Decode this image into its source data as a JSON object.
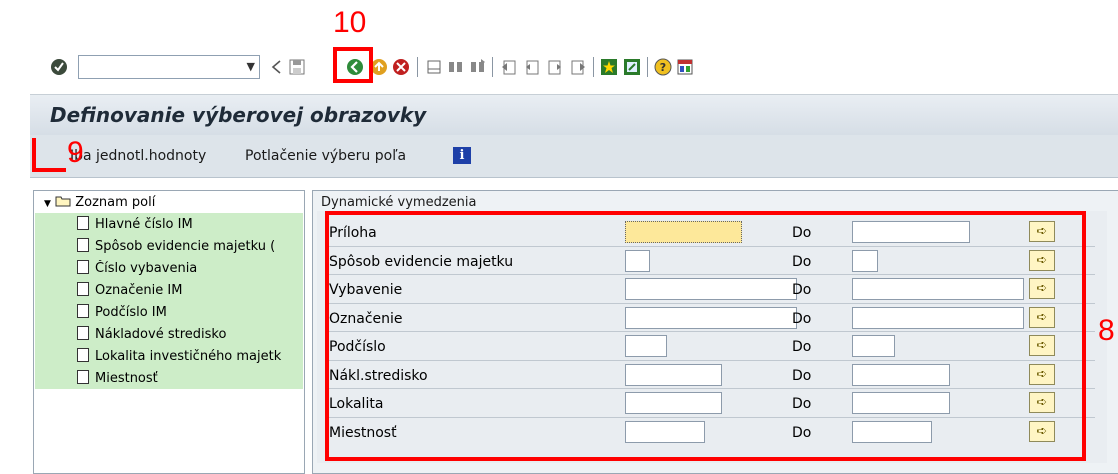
{
  "toolbar": {
    "command_field_value": "",
    "icons": [
      "enter-icon",
      "command-dropdown-icon",
      "back-arrow-icon",
      "save-icon",
      "back-icon",
      "exit-icon",
      "cancel-icon",
      "print-icon",
      "find-icon",
      "find-next-icon",
      "first-page-icon",
      "prev-page-icon",
      "next-page-icon",
      "last-page-icon",
      "new-session-icon",
      "shortcut-icon",
      "help-icon",
      "layout-icon"
    ]
  },
  "title": "Definovanie výberovej obrazovky",
  "app_toolbar": {
    "single_values": "Iba jednotl.hodnoty",
    "suppress_selection": "Potlačenie výberu poľa"
  },
  "tree": {
    "root": "Zoznam polí",
    "items": [
      "Hlavné číslo IM",
      "Spôsob evidencie majetku (",
      "Číslo vybavenia",
      "Označenie IM",
      "Podčíslo IM",
      "Nákladové stredisko",
      "Lokalita investičného majetk",
      "Miestnosť"
    ]
  },
  "group": {
    "title": "Dynamické vymedzenia",
    "do_label": "Do",
    "rows": [
      {
        "label": "Príloha",
        "from": "",
        "to": ""
      },
      {
        "label": "Spôsob evidencie majetku",
        "from": "",
        "to": ""
      },
      {
        "label": "Vybavenie",
        "from": "",
        "to": ""
      },
      {
        "label": "Označenie",
        "from": "",
        "to": ""
      },
      {
        "label": "Podčíslo",
        "from": "",
        "to": ""
      },
      {
        "label": "Nákl.stredisko",
        "from": "",
        "to": ""
      },
      {
        "label": "Lokalita",
        "from": "",
        "to": ""
      },
      {
        "label": "Miestnosť",
        "from": "",
        "to": ""
      }
    ]
  },
  "annotations": {
    "label_10": "10",
    "label_9": "9",
    "label_8": "8"
  },
  "colors": {
    "annotation": "#ff0000",
    "tree_highlight": "#cdedc8",
    "input_highlight": "#fde89a"
  }
}
